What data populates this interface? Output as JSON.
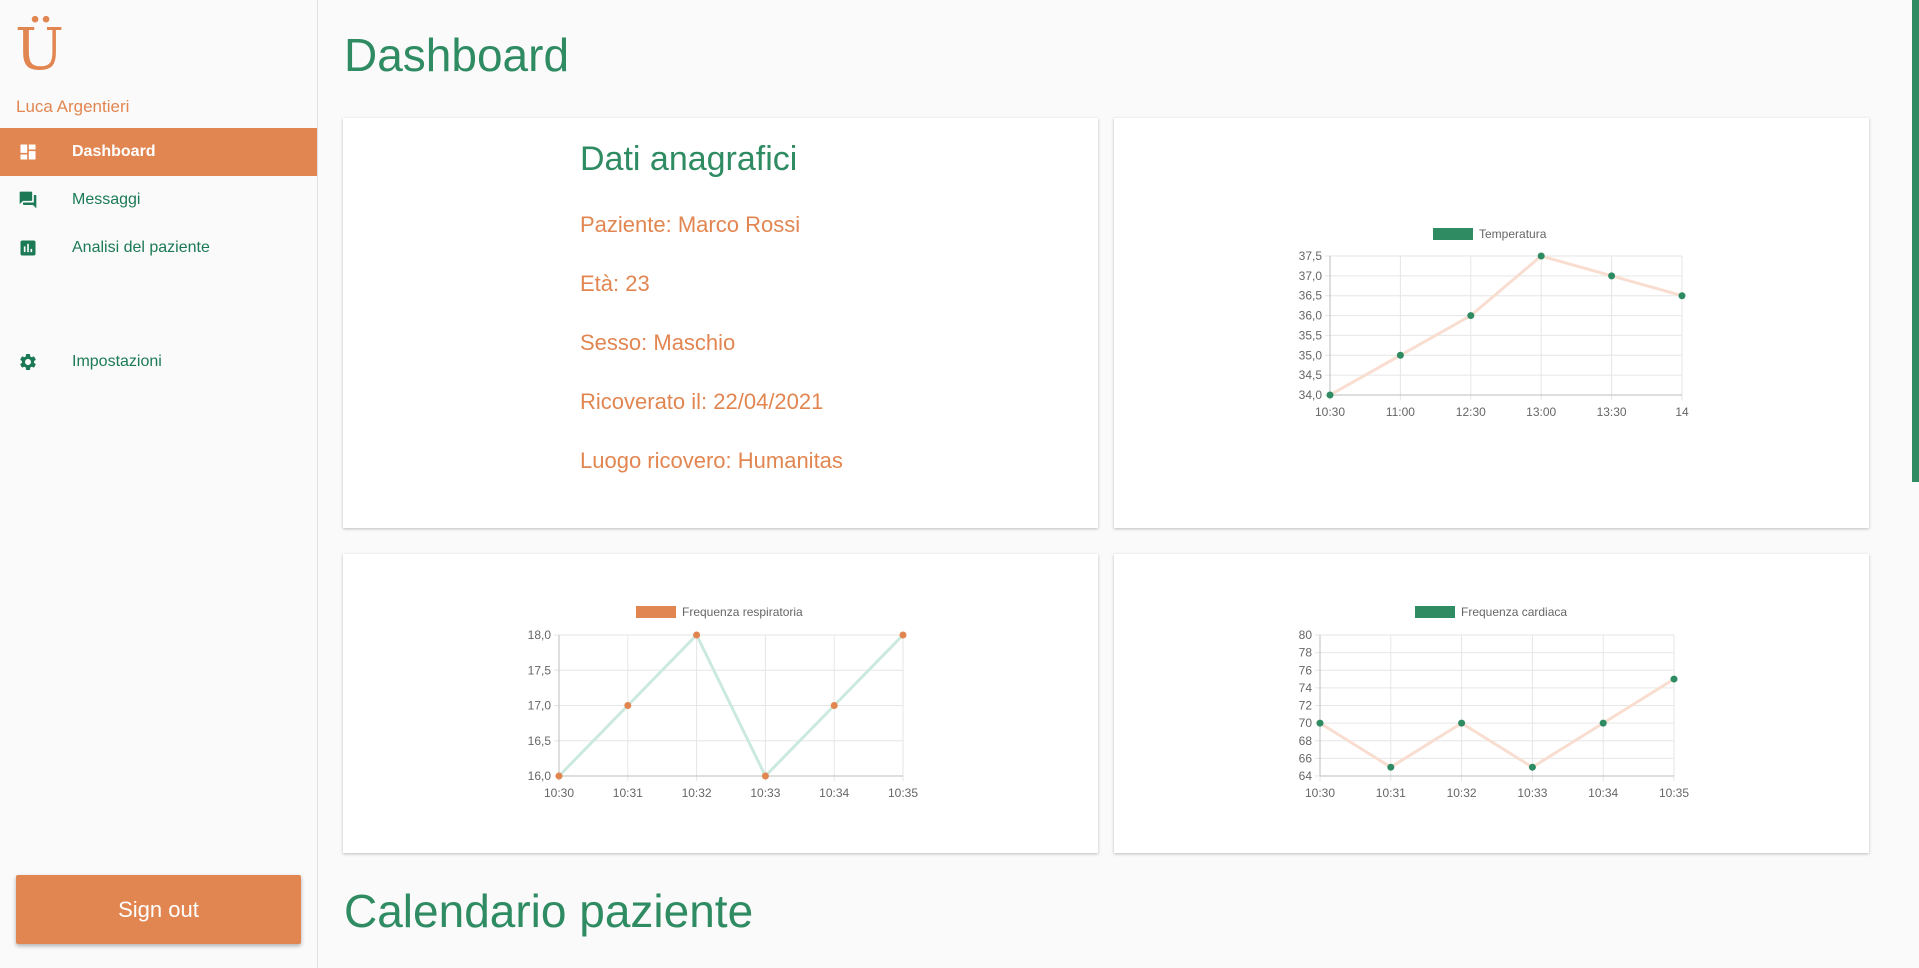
{
  "sidebar": {
    "logo": "Ü",
    "user_name": "Luca Argentieri",
    "items": [
      {
        "label": "Dashboard",
        "icon": "dashboard-icon",
        "active": true
      },
      {
        "label": "Messaggi",
        "icon": "forum-icon",
        "active": false
      },
      {
        "label": "Analisi del paziente",
        "icon": "analytics-icon",
        "active": false
      },
      {
        "label": "Impostazioni",
        "icon": "gear-icon",
        "active": false
      }
    ],
    "signout_label": "Sign out"
  },
  "main": {
    "title": "Dashboard",
    "calendar_title": "Calendario paziente",
    "info": {
      "title": "Dati anagrafici",
      "lines": [
        "Paziente: Marco Rossi",
        "Età: 23",
        "Sesso: Maschio",
        "Ricoverato il: 22/04/2021",
        "Luogo ricovero: Humanitas"
      ]
    }
  },
  "colors": {
    "accent": "#e28651",
    "primary": "#2e8b62"
  },
  "chart_data": [
    {
      "type": "line",
      "series": [
        {
          "name": "Temperatura",
          "values": [
            34.0,
            35.0,
            36.0,
            37.5,
            37.0,
            36.5
          ]
        }
      ],
      "categories": [
        "10:30",
        "11:00",
        "12:30",
        "13:00",
        "13:30",
        "14"
      ],
      "ylim": [
        34.0,
        37.5
      ],
      "yticks": [
        "37,5",
        "37,0",
        "36,5",
        "36,0",
        "35,5",
        "35,0",
        "34,5",
        "34,0"
      ],
      "legend": "top",
      "grid": true
    },
    {
      "type": "line",
      "series": [
        {
          "name": "Frequenza respiratoria",
          "values": [
            16,
            17,
            18,
            16,
            17,
            18
          ]
        }
      ],
      "categories": [
        "10:30",
        "10:31",
        "10:32",
        "10:33",
        "10:34",
        "10:35"
      ],
      "ylim": [
        16.0,
        18.0
      ],
      "yticks": [
        "18,0",
        "17,5",
        "17,0",
        "16,5",
        "16,0"
      ],
      "legend": "top",
      "grid": true
    },
    {
      "type": "line",
      "series": [
        {
          "name": "Frequenza cardiaca",
          "values": [
            70,
            65,
            70,
            65,
            70,
            75
          ]
        }
      ],
      "categories": [
        "10:30",
        "10:31",
        "10:32",
        "10:33",
        "10:34",
        "10:35"
      ],
      "ylim": [
        64,
        80
      ],
      "yticks": [
        "80",
        "78",
        "76",
        "74",
        "72",
        "70",
        "68",
        "66",
        "64"
      ],
      "legend": "top",
      "grid": true
    }
  ]
}
